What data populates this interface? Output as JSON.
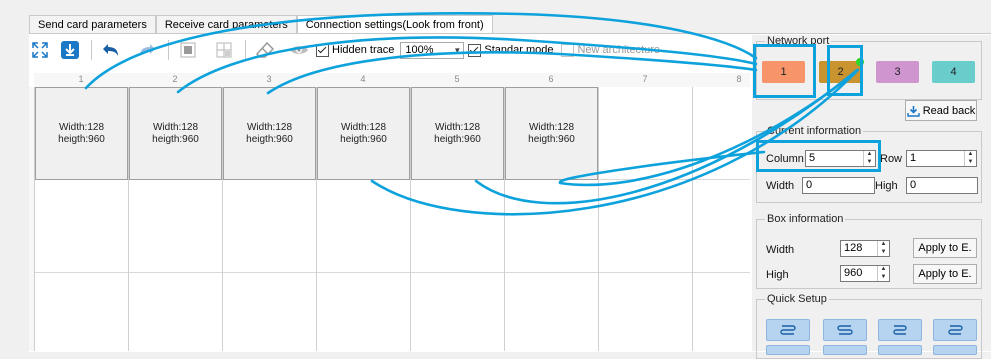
{
  "tabs": [
    {
      "label": "Send card parameters"
    },
    {
      "label": "Receive card parameters"
    },
    {
      "label": "Connection settings(Look from front)"
    }
  ],
  "toolbar": {
    "hidden_trace_label": "Hidden trace",
    "zoom_value": "100%",
    "standard_mode_label": "Standar mode",
    "new_architecture_label": "New architecture"
  },
  "ruler": {
    "columns": [
      "1",
      "2",
      "3",
      "4",
      "5",
      "6",
      "7",
      "8"
    ]
  },
  "cells": [
    {
      "width": "Width:128",
      "height": "heigth:960"
    },
    {
      "width": "Width:128",
      "height": "heigth:960"
    },
    {
      "width": "Width:128",
      "height": "heigth:960"
    },
    {
      "width": "Width:128",
      "height": "heigth:960"
    },
    {
      "width": "Width:128",
      "height": "heigth:960"
    },
    {
      "width": "Width:128",
      "height": "heigth:960"
    }
  ],
  "side": {
    "network_port_title": "Network port",
    "ports": [
      {
        "label": "1",
        "color": "#f79469"
      },
      {
        "label": "2",
        "color": "#c9932f"
      },
      {
        "label": "3",
        "color": "#cf95cf"
      },
      {
        "label": "4",
        "color": "#69cdcc"
      }
    ],
    "read_back_label": "Read back",
    "current_info_title": "Current information",
    "column_label": "Column",
    "column_value": "5",
    "row_label": "Row",
    "row_value": "1",
    "width_label": "Width",
    "width_value": "0",
    "high_label": "High",
    "high_value": "0",
    "box_info_title": "Box information",
    "box_width_label": "Width",
    "box_width_value": "128",
    "box_high_label": "High",
    "box_high_value": "960",
    "apply_label": "Apply to E.",
    "quick_setup_title": "Quick Setup"
  },
  "accent": "#0ea2dc"
}
